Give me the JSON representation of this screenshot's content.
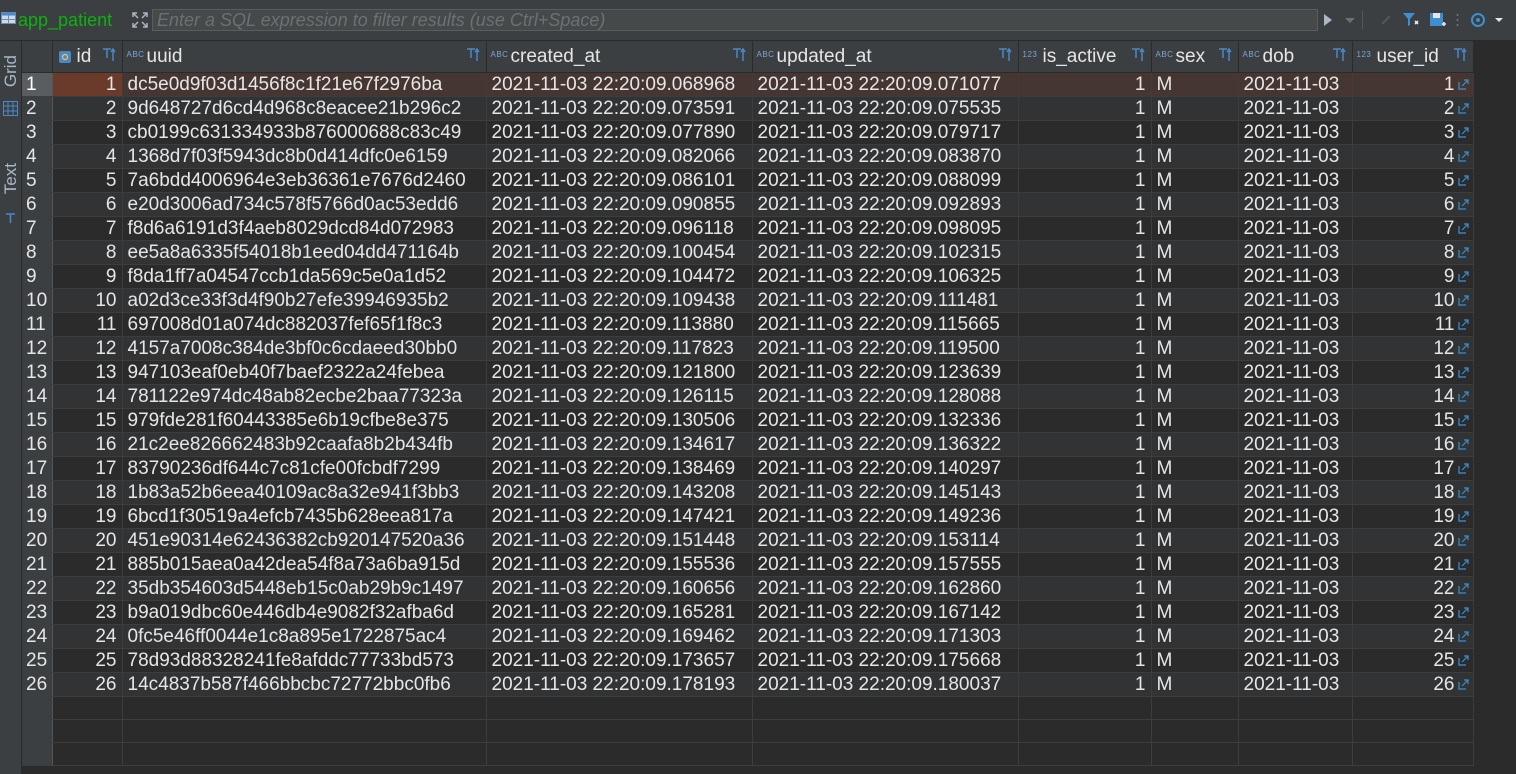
{
  "toolbar": {
    "table_name": "app_patient",
    "filter_placeholder": "Enter a SQL expression to filter results (use Ctrl+Space)",
    "filter_value": ""
  },
  "sidebar": {
    "tabs": [
      {
        "label": "Grid",
        "icon": "grid-icon",
        "active": true
      },
      {
        "label": "Text",
        "icon": "text-icon",
        "active": false
      }
    ]
  },
  "colors": {
    "table_name": "#0cb20c",
    "header_bg": "#3c3f41",
    "row_even": "#2b2b2b",
    "row_odd": "#313335",
    "selected_row": "#463631",
    "type_icon": "#7aa6d6"
  },
  "columns": [
    {
      "name": "id",
      "type_icon": "key-icon"
    },
    {
      "name": "uuid",
      "type_icon": "ABC"
    },
    {
      "name": "created_at",
      "type_icon": "ABC"
    },
    {
      "name": "updated_at",
      "type_icon": "ABC"
    },
    {
      "name": "is_active",
      "type_icon": "123"
    },
    {
      "name": "sex",
      "type_icon": "ABC"
    },
    {
      "name": "dob",
      "type_icon": "ABC"
    },
    {
      "name": "user_id",
      "type_icon": "123"
    }
  ],
  "rows": [
    [
      "1",
      "1",
      "dc5e0d9f03d1456f8c1f21e67f2976ba",
      "2021-11-03 22:20:09.068968",
      "2021-11-03 22:20:09.071077",
      "1",
      "M",
      "2021-11-03",
      "1"
    ],
    [
      "2",
      "2",
      "9d648727d6cd4d968c8eacee21b296c2",
      "2021-11-03 22:20:09.073591",
      "2021-11-03 22:20:09.075535",
      "1",
      "M",
      "2021-11-03",
      "2"
    ],
    [
      "3",
      "3",
      "cb0199c631334933b876000688c83c49",
      "2021-11-03 22:20:09.077890",
      "2021-11-03 22:20:09.079717",
      "1",
      "M",
      "2021-11-03",
      "3"
    ],
    [
      "4",
      "4",
      "1368d7f03f5943dc8b0d414dfc0e6159",
      "2021-11-03 22:20:09.082066",
      "2021-11-03 22:20:09.083870",
      "1",
      "M",
      "2021-11-03",
      "4"
    ],
    [
      "5",
      "5",
      "7a6bdd4006964e3eb36361e7676d2460",
      "2021-11-03 22:20:09.086101",
      "2021-11-03 22:20:09.088099",
      "1",
      "M",
      "2021-11-03",
      "5"
    ],
    [
      "6",
      "6",
      "e20d3006ad734c578f5766d0ac53edd6",
      "2021-11-03 22:20:09.090855",
      "2021-11-03 22:20:09.092893",
      "1",
      "M",
      "2021-11-03",
      "6"
    ],
    [
      "7",
      "7",
      "f8d6a6191d3f4aeb8029dcd84d072983",
      "2021-11-03 22:20:09.096118",
      "2021-11-03 22:20:09.098095",
      "1",
      "M",
      "2021-11-03",
      "7"
    ],
    [
      "8",
      "8",
      "ee5a8a6335f54018b1eed04dd471164b",
      "2021-11-03 22:20:09.100454",
      "2021-11-03 22:20:09.102315",
      "1",
      "M",
      "2021-11-03",
      "8"
    ],
    [
      "9",
      "9",
      "f8da1ff7a04547ccb1da569c5e0a1d52",
      "2021-11-03 22:20:09.104472",
      "2021-11-03 22:20:09.106325",
      "1",
      "M",
      "2021-11-03",
      "9"
    ],
    [
      "10",
      "10",
      "a02d3ce33f3d4f90b27efe39946935b2",
      "2021-11-03 22:20:09.109438",
      "2021-11-03 22:20:09.111481",
      "1",
      "M",
      "2021-11-03",
      "10"
    ],
    [
      "11",
      "11",
      "697008d01a074dc882037fef65f1f8c3",
      "2021-11-03 22:20:09.113880",
      "2021-11-03 22:20:09.115665",
      "1",
      "M",
      "2021-11-03",
      "11"
    ],
    [
      "12",
      "12",
      "4157a7008c384de3bf0c6cdaeed30bb0",
      "2021-11-03 22:20:09.117823",
      "2021-11-03 22:20:09.119500",
      "1",
      "M",
      "2021-11-03",
      "12"
    ],
    [
      "13",
      "13",
      "947103eaf0eb40f7baef2322a24febea",
      "2021-11-03 22:20:09.121800",
      "2021-11-03 22:20:09.123639",
      "1",
      "M",
      "2021-11-03",
      "13"
    ],
    [
      "14",
      "14",
      "781122e974dc48ab82ecbe2baa77323a",
      "2021-11-03 22:20:09.126115",
      "2021-11-03 22:20:09.128088",
      "1",
      "M",
      "2021-11-03",
      "14"
    ],
    [
      "15",
      "15",
      "979fde281f60443385e6b19cfbe8e375",
      "2021-11-03 22:20:09.130506",
      "2021-11-03 22:20:09.132336",
      "1",
      "M",
      "2021-11-03",
      "15"
    ],
    [
      "16",
      "16",
      "21c2ee826662483b92caafa8b2b434fb",
      "2021-11-03 22:20:09.134617",
      "2021-11-03 22:20:09.136322",
      "1",
      "M",
      "2021-11-03",
      "16"
    ],
    [
      "17",
      "17",
      "83790236df644c7c81cfe00fcbdf7299",
      "2021-11-03 22:20:09.138469",
      "2021-11-03 22:20:09.140297",
      "1",
      "M",
      "2021-11-03",
      "17"
    ],
    [
      "18",
      "18",
      "1b83a52b6eea40109ac8a32e941f3bb3",
      "2021-11-03 22:20:09.143208",
      "2021-11-03 22:20:09.145143",
      "1",
      "M",
      "2021-11-03",
      "18"
    ],
    [
      "19",
      "19",
      "6bcd1f30519a4efcb7435b628eea817a",
      "2021-11-03 22:20:09.147421",
      "2021-11-03 22:20:09.149236",
      "1",
      "M",
      "2021-11-03",
      "19"
    ],
    [
      "20",
      "20",
      "451e90314e62436382cb920147520a36",
      "2021-11-03 22:20:09.151448",
      "2021-11-03 22:20:09.153114",
      "1",
      "M",
      "2021-11-03",
      "20"
    ],
    [
      "21",
      "21",
      "885b015aea0a42dea54f8a73a6ba915d",
      "2021-11-03 22:20:09.155536",
      "2021-11-03 22:20:09.157555",
      "1",
      "M",
      "2021-11-03",
      "21"
    ],
    [
      "22",
      "22",
      "35db354603d5448eb15c0ab29b9c1497",
      "2021-11-03 22:20:09.160656",
      "2021-11-03 22:20:09.162860",
      "1",
      "M",
      "2021-11-03",
      "22"
    ],
    [
      "23",
      "23",
      "b9a019dbc60e446db4e9082f32afba6d",
      "2021-11-03 22:20:09.165281",
      "2021-11-03 22:20:09.167142",
      "1",
      "M",
      "2021-11-03",
      "23"
    ],
    [
      "24",
      "24",
      "0fc5e46ff0044e1c8a895e1722875ac4",
      "2021-11-03 22:20:09.169462",
      "2021-11-03 22:20:09.171303",
      "1",
      "M",
      "2021-11-03",
      "24"
    ],
    [
      "25",
      "25",
      "78d93d88328241fe8afddc77733bd573",
      "2021-11-03 22:20:09.173657",
      "2021-11-03 22:20:09.175668",
      "1",
      "M",
      "2021-11-03",
      "25"
    ],
    [
      "26",
      "26",
      "14c4837b587f466bbcbc72772bbc0fb6",
      "2021-11-03 22:20:09.178193",
      "2021-11-03 22:20:09.180037",
      "1",
      "M",
      "2021-11-03",
      "26"
    ]
  ],
  "selected_row_index": 0
}
